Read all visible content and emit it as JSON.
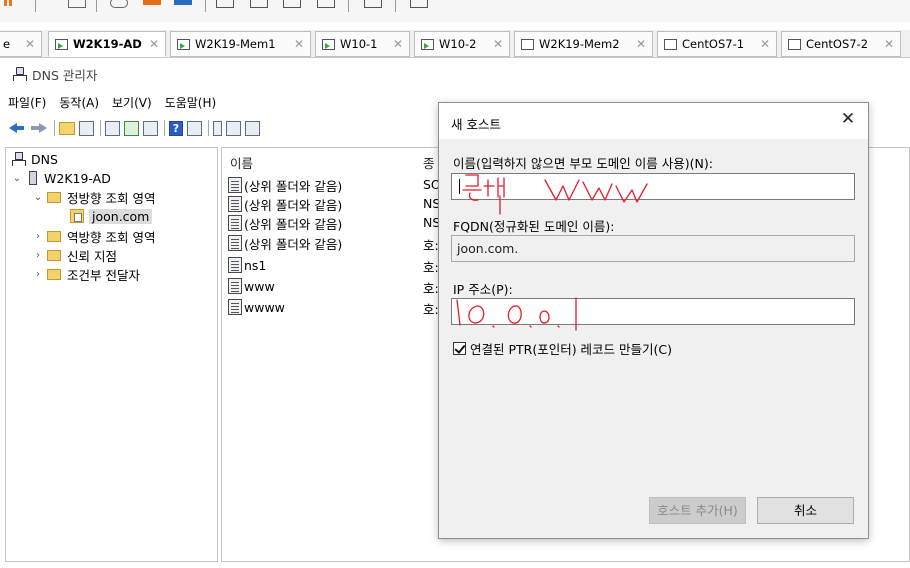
{
  "vm_tabs": [
    {
      "label": "W2K19-AD",
      "active": true
    },
    {
      "label": "W2K19-Mem1"
    },
    {
      "label": "W10-1"
    },
    {
      "label": "W10-2"
    },
    {
      "label": "W2K19-Mem2"
    },
    {
      "label": "CentOS7-1"
    },
    {
      "label": "CentOS7-2"
    }
  ],
  "window": {
    "title": "DNS 관리자"
  },
  "menu": [
    "파일(F)",
    "동작(A)",
    "보기(V)",
    "도움말(H)"
  ],
  "tree": {
    "root": "DNS",
    "server": "W2K19-AD",
    "forward_zone": "정방향 조회 영역",
    "zone": "joon.com",
    "reverse_zone": "역방향 조회 영역",
    "trust_points": "신뢰 지점",
    "conditional_forwarders": "조건부 전달자"
  },
  "list": {
    "col_name": "이름",
    "col_type": "종",
    "rows": [
      {
        "name": "(상위 폴더와 같음)",
        "type": "SO"
      },
      {
        "name": "(상위 폴더와 같음)",
        "type": "NS"
      },
      {
        "name": "(상위 폴더와 같음)",
        "type": "NS"
      },
      {
        "name": "(상위 폴더와 같음)",
        "type": "호:"
      },
      {
        "name": "ns1",
        "type": "호:"
      },
      {
        "name": "www",
        "type": "호:"
      },
      {
        "name": "wwww",
        "type": "호:"
      }
    ]
  },
  "dialog": {
    "title": "새 호스트",
    "name_label": "이름(입력하지 않으면 부모 도메인 이름 사용)(N):",
    "name_value": "",
    "fqdn_label": "FQDN(정규화된 도메인 이름):",
    "fqdn_value": "joon.com.",
    "ip_label": "IP 주소(P):",
    "ip_value": "",
    "ptr_checkbox": "연결된 PTR(포인터) 레코드 만들기(C)",
    "ptr_checked": true,
    "add_button": "호스트 추가(H)",
    "cancel_button": "취소"
  },
  "colors": {
    "ink": "#e8192c",
    "tab_play": "#39a845"
  }
}
